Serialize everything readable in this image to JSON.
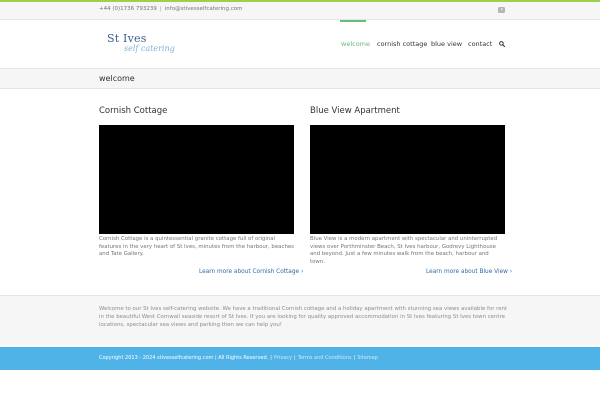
{
  "topbar": {
    "phone": "+44 (0)1736 793239",
    "email": "info@stivesselfcatering.com",
    "social_icon": "youtube-icon"
  },
  "logo": {
    "line1": "St Ives",
    "line2": "self catering"
  },
  "nav": {
    "items": [
      {
        "label": "welcome"
      },
      {
        "label": "cornish cottage"
      },
      {
        "label": "blue view"
      },
      {
        "label": "contact"
      }
    ],
    "active_index": 0,
    "active_color": "#65bc7b",
    "search_icon": "search-icon"
  },
  "page": {
    "title": "welcome"
  },
  "columns": [
    {
      "title": "Cornish Cottage",
      "text": "Cornish Cottage is a quintessential granite cottage full of original features in the very heart of St Ives, minutes from the harbour, beaches and Tate Gallery.",
      "link": "Learn more about Cornish Cottage ›"
    },
    {
      "title": "Blue View Apartment",
      "text": "Blue View is a modern apartment with spectacular and uninterrupted views over Porthminster Beach, St Ives harbour, Godrevy Lighthouse and beyond. Just a few minutes walk from the beach, harbour and town.",
      "link": "Learn more about Blue View ›"
    }
  ],
  "intro": {
    "text": "Welcome to our St Ives self-catering website. We have a traditional Cornish cottage and a holiday apartment with stunning sea views available for rent in the beautiful West Cornwall seaside resort of St Ives. If you are looking for quality approved accommodation in St Ives featuring St Ives town centre locations, spectacular sea views and parking then we can help you!"
  },
  "footer": {
    "copyright": "Copyright 2013 - 2024 stivesselfcatering.com | All Rights Reserved.",
    "links": [
      "Privacy",
      "Terms and Conditions",
      "Sitemap"
    ],
    "bg_color": "#4fb3e8"
  }
}
